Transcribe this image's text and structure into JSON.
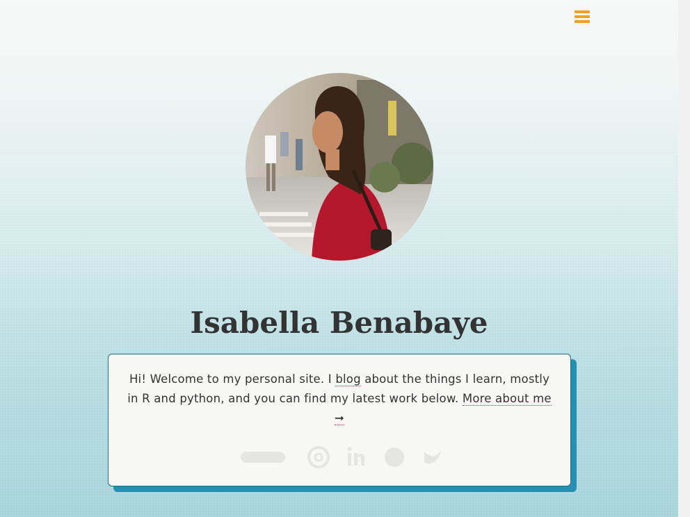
{
  "header": {
    "menu_icon": "hamburger-menu-icon",
    "accent_color": "#f2a024"
  },
  "profile": {
    "name": "Isabella Benabaye",
    "avatar_alt": "photo"
  },
  "intro": {
    "text_before_blog": "Hi! Welcome to my personal site. I ",
    "blog_link": "blog",
    "text_after_blog": " about the things I learn, mostly in R and python, and you can find my latest work below. ",
    "more_link": "More about me",
    "more_arrow": "➞"
  },
  "social": {
    "items": [
      "resume-icon",
      "email-icon",
      "linkedin-icon",
      "github-icon",
      "twitter-icon"
    ]
  },
  "colors": {
    "card_shadow": "#2590b3",
    "card_bg": "#f7f7f6",
    "text": "#333333"
  }
}
